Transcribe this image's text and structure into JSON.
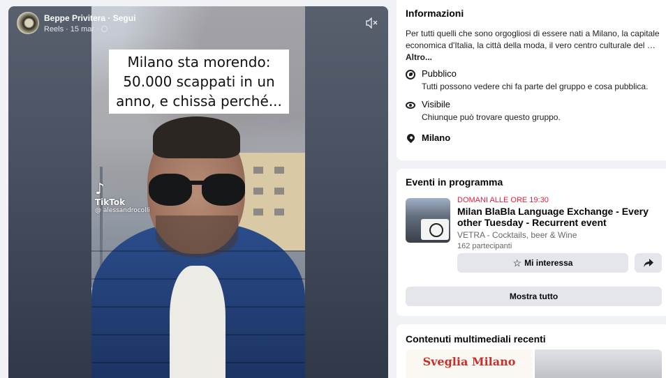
{
  "reel": {
    "author": "Beppe Privitera",
    "separator": "·",
    "follow_label": "Segui",
    "source": "Reels",
    "date": "15 mar",
    "caption_line1": "Milano sta morendo:",
    "caption_line2": "50.000 scappati in un",
    "caption_line3": "anno, e chissà perché...",
    "tiktok_brand": "TikTok",
    "tiktok_handle": "@ alessandrocolli",
    "mute_icon": "speaker-muted-icon"
  },
  "info": {
    "title": "Informazioni",
    "description": "Per tutti quelli che sono orgogliosi di essere nati a Milano, la capitale economica d'Italia, la città della moda, il vero centro culturale del …",
    "more_label": "Altro...",
    "privacy_title": "Pubblico",
    "privacy_desc": "Tutti possono vedere chi fa parte del gruppo e cosa pubblica.",
    "visibility_title": "Visibile",
    "visibility_desc": "Chiunque può trovare questo gruppo.",
    "location": "Milano"
  },
  "events": {
    "title": "Eventi in programma",
    "date": "DOMANI ALLE ORE 19:30",
    "name": "Milan BlaBla Language Exchange - Every other Tuesday - Recurrent event",
    "venue": "VETRA - Cocktails, beer & Wine",
    "attendees": "162 partecipanti",
    "interest_label": "Mi interessa",
    "show_all_label": "Mostra tutto"
  },
  "media": {
    "title": "Contenuti multimediali recenti",
    "thumb1_text": "Sveglia Milano"
  },
  "colors": {
    "accent_red": "#e41e3f",
    "button_gray": "#e4e6eb",
    "background": "#f0f2f5"
  }
}
